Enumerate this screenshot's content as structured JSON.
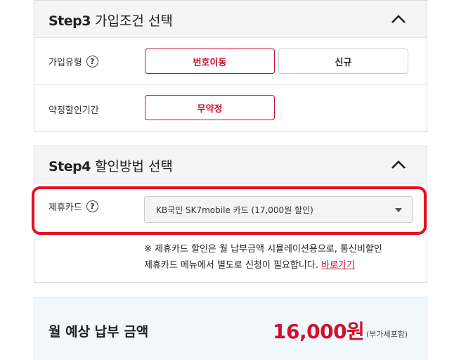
{
  "step3": {
    "step": "Step3",
    "title": "가입조건 선택",
    "join_type_label": "가입유형",
    "help": "?",
    "options": [
      "번호이동",
      "신규"
    ],
    "selected_option": "번호이동",
    "contract_label": "약정할인기간",
    "contract_option": "무약정"
  },
  "step4": {
    "step": "Step4",
    "title": "할인방법 선택",
    "card_label": "제휴카드",
    "help": "?",
    "card_select_value": "KB국민 SK7mobile 카드 (17,000원 할인)",
    "notice_line1": "※ 제휴카드 할인은 월 납부금액 시뮬레이션용으로, 통신비할인",
    "notice_line2": "제휴카드 메뉴에서 별도로 신청이 필요합니다.",
    "notice_link": "바로가기"
  },
  "total": {
    "label": "월 예상 납부 금액",
    "price": "16,000원",
    "vat": "(부가세포함)"
  },
  "colors": {
    "accent": "#c4112f",
    "highlight": "#e8101f",
    "price": "#d0112b"
  },
  "icons": [
    "chevron-up-icon",
    "help-icon",
    "dropdown-caret-icon"
  ]
}
